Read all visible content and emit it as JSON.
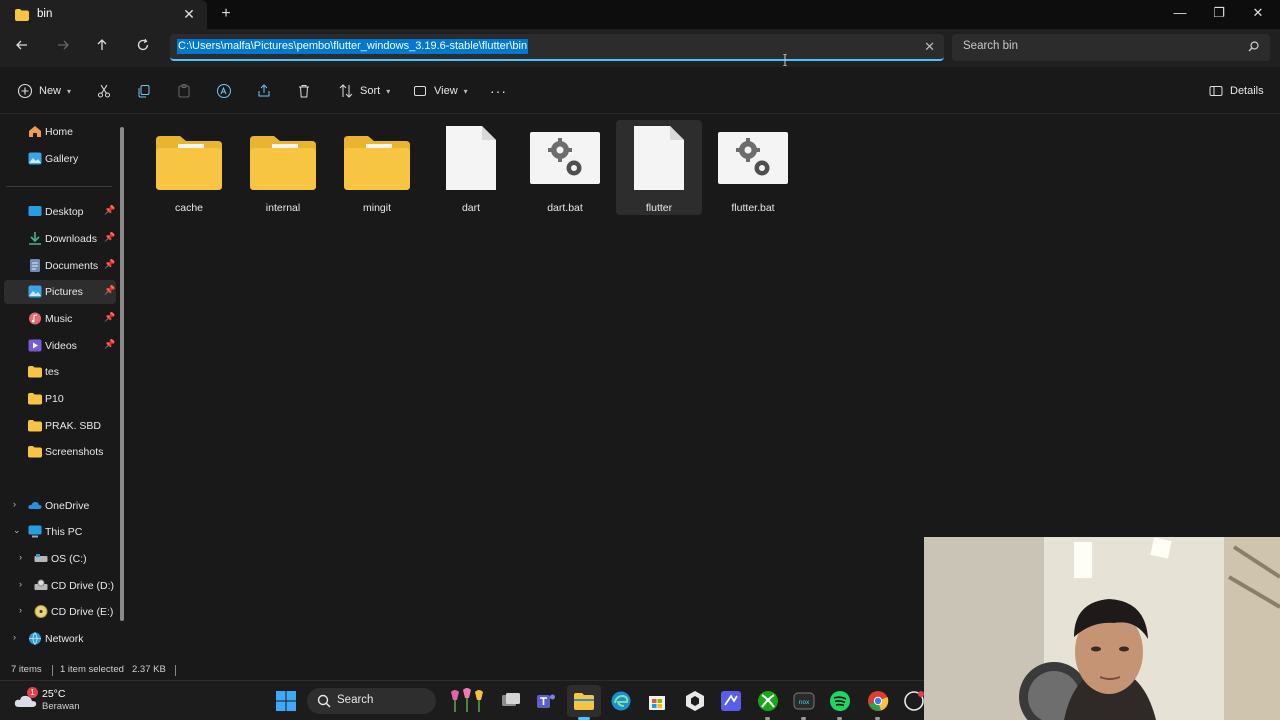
{
  "window": {
    "tab_title": "bin",
    "tab_close": "✕",
    "new_tab": "+",
    "minimize": "—",
    "maximize": "❐",
    "close": "✕"
  },
  "address": {
    "path": "C:\\Users\\malfa\\Pictures\\pembo\\flutter_windows_3.19.6-stable\\flutter\\bin",
    "clear": "✕",
    "search_placeholder": "Search bin"
  },
  "toolbar": {
    "new_label": "New",
    "sort_label": "Sort",
    "view_label": "View",
    "more_label": "···",
    "details_label": "Details"
  },
  "sidebar": {
    "items": [
      {
        "label": "Home",
        "icon": "home-icon"
      },
      {
        "label": "Gallery",
        "icon": "gallery-icon"
      },
      {
        "label": "Desktop",
        "icon": "desktop-icon",
        "pinned": true
      },
      {
        "label": "Downloads",
        "icon": "downloads-icon",
        "pinned": true
      },
      {
        "label": "Documents",
        "icon": "documents-icon",
        "pinned": true
      },
      {
        "label": "Pictures",
        "icon": "pictures-icon",
        "pinned": true,
        "selected": true
      },
      {
        "label": "Music",
        "icon": "music-icon",
        "pinned": true
      },
      {
        "label": "Videos",
        "icon": "videos-icon",
        "pinned": true
      },
      {
        "label": "tes",
        "icon": "folder-icon"
      },
      {
        "label": "P10",
        "icon": "folder-icon"
      },
      {
        "label": "PRAK. SBD",
        "icon": "folder-icon"
      },
      {
        "label": "Screenshots",
        "icon": "folder-icon"
      },
      {
        "label": "OneDrive",
        "icon": "onedrive-icon"
      },
      {
        "label": "This PC",
        "icon": "this-pc-icon",
        "expanded": true
      },
      {
        "label": "OS (C:)",
        "icon": "drive-icon"
      },
      {
        "label": "CD Drive (D:)",
        "icon": "cd-drive-icon"
      },
      {
        "label": "CD Drive (E:)",
        "icon": "cd-drive-icon"
      },
      {
        "label": "Network",
        "icon": "network-icon"
      }
    ]
  },
  "files": [
    {
      "name": "cache",
      "type": "folder"
    },
    {
      "name": "internal",
      "type": "folder"
    },
    {
      "name": "mingit",
      "type": "folder"
    },
    {
      "name": "dart",
      "type": "file"
    },
    {
      "name": "dart.bat",
      "type": "batch"
    },
    {
      "name": "flutter",
      "type": "file",
      "selected": true
    },
    {
      "name": "flutter.bat",
      "type": "batch"
    }
  ],
  "status": {
    "item_count": "7 items",
    "selection": "1 item selected",
    "size": "2.37 KB"
  },
  "taskbar": {
    "temperature": "25°C",
    "condition": "Berawan",
    "weather_badge": "1",
    "search_label": "Search"
  },
  "colors": {
    "accent": "#4cc2ff",
    "selection": "#0078d4",
    "folder": "#f8c542"
  }
}
